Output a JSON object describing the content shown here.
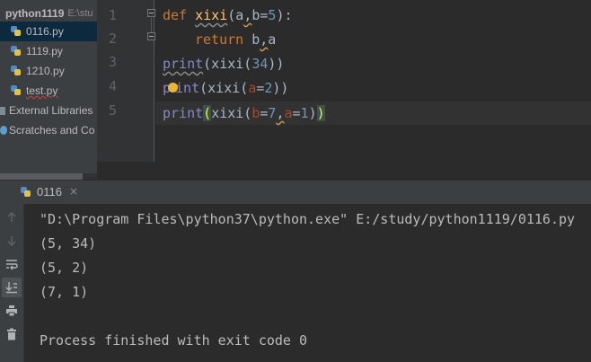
{
  "project": {
    "root_name": "python1119",
    "root_path": "E:\\stu",
    "files": [
      {
        "name": "0116.py",
        "selected": true
      },
      {
        "name": "1119.py",
        "selected": false
      },
      {
        "name": "1210.py",
        "selected": false
      },
      {
        "name": "test.py",
        "selected": false
      }
    ],
    "external_libraries": "External Libraries",
    "scratches": "Scratches and Co"
  },
  "editor": {
    "line_numbers": [
      "1",
      "2",
      "3",
      "4",
      "5"
    ],
    "line1": {
      "kw": "def",
      "fn": "xixi",
      "p1": "(a",
      "comma": ",",
      "p2": "b=",
      "num": "5",
      "p3": "):"
    },
    "line2": {
      "kw": "return",
      "a": " b",
      "comma": ",",
      "b": "a"
    },
    "line3": {
      "bi": "print",
      "rest1": "(xixi(",
      "num": "34",
      "rest2": "))"
    },
    "line4": {
      "bi_a": "p",
      "bi_b": "int",
      "rest1": "(xixi(",
      "param": "a",
      "eq": "=",
      "num": "2",
      "rest2": "))"
    },
    "line5": {
      "bi": "print",
      "open": "(",
      "rest1": "xixi(",
      "param1": "b",
      "eq1": "=",
      "num1": "7",
      "comma": ",",
      "param2": "a",
      "eq2": "=",
      "num2": "1",
      "rest2": ")",
      "close": ")"
    }
  },
  "run": {
    "tab_label": "0116",
    "close_glyph": "×",
    "console_lines": [
      "\"D:\\Program Files\\python37\\python.exe\" E:/study/python1119/0116.py",
      "(5, 34)",
      "(5, 2)",
      "(7, 1)",
      "",
      "Process finished with exit code 0"
    ]
  },
  "colors": {
    "keyword": "#cc7832",
    "function": "#ffc66d",
    "builtin": "#8888c6",
    "number": "#6897bb",
    "param": "#aa4926",
    "selection": "#0d293e"
  }
}
